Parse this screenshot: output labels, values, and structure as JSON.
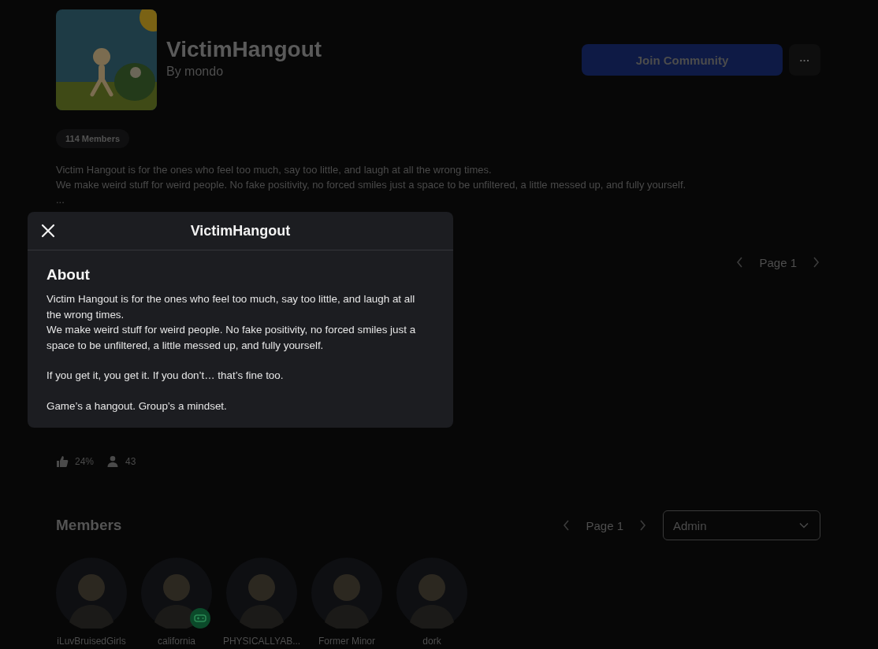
{
  "community": {
    "name": "VictimHangout",
    "owner": "By mondo",
    "members_count": "114 Members",
    "join_button": "Join Community",
    "more_button": "···"
  },
  "description": [
    "Victim Hangout is for the ones who feel too much, say too little, and laugh at all the wrong times.",
    "We make weird stuff for weird people. No fake positivity, no forced smiles just a space to be unfiltered, a little messed up, and fully yourself.",
    "..."
  ],
  "games_pager": {
    "label": "Page 1"
  },
  "stats": [
    {
      "kind": "likes",
      "value": "24%"
    },
    {
      "kind": "players",
      "value": "43"
    }
  ],
  "members": {
    "title": "Members",
    "pager": {
      "label": "Page 1"
    },
    "role_select": {
      "value": "Admin"
    },
    "items": [
      {
        "name": "iLuvBruisedGirls",
        "in_game": false
      },
      {
        "name": "california",
        "in_game": true
      },
      {
        "name": "PHYSICALLYAB...",
        "in_game": false
      },
      {
        "name": "Former Minor",
        "in_game": false
      },
      {
        "name": "dork",
        "in_game": false
      }
    ]
  },
  "modal": {
    "title": "VictimHangout",
    "heading": "About",
    "paragraphs": [
      [
        "Victim Hangout is for the ones who feel too much, say too little, and laugh at all the wrong times.",
        "We make weird stuff for weird people. No fake positivity, no forced smiles just a space to be unfiltered, a little messed up, and fully yourself."
      ],
      [
        "If you get it, you get it. If you don’t… that’s fine too."
      ],
      [
        "Game’s a hangout. Group’s a mindset."
      ]
    ]
  }
}
